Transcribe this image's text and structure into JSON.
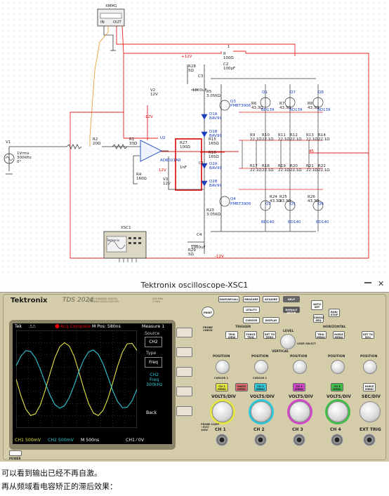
{
  "schematic": {
    "xmm1": "XMM1",
    "xmm1_in": "IN",
    "xmm1_out": "OUT",
    "v1": "V1",
    "v1_spec": "1Vrms\n300kHz\n0°",
    "r2": "R2\n20Ω",
    "r1": "R1\n33Ω",
    "u2": "U2",
    "opamp": "AD8021AR",
    "v2": "V2\n12V",
    "v3": "V3\n12V",
    "r4": "R4\n160Ω",
    "r27": "R27\n100Ω",
    "c1": "1nF",
    "c1_label": "C1",
    "plus12v": "+12V",
    "minus12v": "-12V",
    "vcc_label": "12V",
    "vee_label": "-12V",
    "r28": "R28\n5Ω",
    "c3": "C3",
    "c3_val": "1000uF",
    "r5": "R5\n3.05KΩ",
    "q3": "Q3",
    "q3_model": "PMBT3906",
    "q4": "Q4",
    "q4_model": "PMBT3906",
    "d1a": "D1A\nBAV99",
    "d1b": "D1B\nBAV99",
    "d2a": "D2A\nBAV99",
    "d2b": "D2B\nBAV99",
    "r15": "R15\n165Ω",
    "r16": "R16\n165Ω",
    "r23": "R23\n3.05KΩ",
    "c4": "C4",
    "c4_val": "1000uF",
    "r29": "R29\n5Ω",
    "r1top": "R\n100Ω",
    "c_top": "C2\n100pF",
    "top_node": "1",
    "q1": "Q1",
    "q7": "Q7",
    "q8": "Q8",
    "bd139a": "BD139",
    "bd139b": "BD139",
    "bd139c": "BD139",
    "q2": "Q2",
    "q5": "Q5",
    "q6": "Q6",
    "bd140a": "BD140",
    "bd140b": "BD140",
    "bd140c": "BD140",
    "r6": "R6\n43.3Ω",
    "r7": "R7\n43.3Ω",
    "r8": "R8\n43.3Ω",
    "r24": "R24\n43.3Ω",
    "r25": "R25\n43.3Ω",
    "r26": "R26\n43.3Ω",
    "r9": "R9\n22.1Ω",
    "r10": "R10\n22.1Ω",
    "r11": "R11\n22.1Ω",
    "r12": "R12\n22.1Ω",
    "r13": "R13\n22.1Ω",
    "r14": "R14\n22.1Ω",
    "r17": "R17\n22.1Ω",
    "r18": "R18\n22.1Ω",
    "r19": "R19\n22.1Ω",
    "r20": "R20\n22.1Ω",
    "r21": "R21\n22.1Ω",
    "r22": "R22\n22.1Ω",
    "node45": "45",
    "xsc1": "XSC1",
    "tektronix_small": "Tektronix"
  },
  "window": {
    "title": "Tektronix oscilloscope-XSC1",
    "close_glyph": "✕"
  },
  "scope": {
    "brand": "Tektronix",
    "model": "TDS 2024",
    "model_sub": "FOUR CHANNEL DIGITAL STORAGE OSCILLOSCOPE",
    "bandwidth": "200 MHz\n2 GS/s",
    "status_tek": "Tek",
    "status_trig": "Acq Complete",
    "status_mpos": "M Pos: 580ns",
    "menu_title": "Measure 1",
    "menu": [
      {
        "label": "Source",
        "value": "CH2"
      },
      {
        "label": "Type",
        "value": "Freq"
      },
      {
        "label": "CH2\nFreq\n300kHz",
        "value": ""
      },
      {
        "label": "Back",
        "value": ""
      }
    ],
    "bottom_ch1": "CH1 500mV",
    "bottom_ch2": "CH2 500mV",
    "bottom_m": "M 500ns",
    "bottom_trig": "CH1 ⁄ 0V",
    "power": "POWER",
    "buttons": {
      "print": "PRINT",
      "save_recall": "SAVE/RECALL",
      "measure": "MEASURE",
      "acquire": "ACQUIRE",
      "help": "HELP",
      "default_setup": "DEFAULT SETUP",
      "utility": "UTILITY",
      "cursor": "CURSOR",
      "display": "DISPLAY",
      "auto_set": "AUTO SET",
      "single_seq": "SINGLE SEQ",
      "run_stop": "RUN/ STOP",
      "probe_check": "PROBE CHECK",
      "trig_view": "TRIG VIEW",
      "force_trig": "FORCE TRIG",
      "set_to_zero": "SET TO ZERO",
      "trig_menu": "TRIG MENU",
      "horiz_menu": "HORIZ MENU",
      "set_to_50": "SET TO 50%",
      "ch1_menu": "CH 1 MENU",
      "math_menu": "MATH MENU",
      "ch2_menu": "CH 2 MENU",
      "ch3_menu": "CH 3 MENU",
      "ch4_menu": "CH 4 MENU"
    },
    "labels": {
      "trigger": "TRIGGER",
      "level": "LEVEL",
      "user_select": "USER SELECT",
      "horizontal": "HORIZONTAL",
      "vertical": "VERTICAL",
      "position": "POSITION",
      "cursor1": "CURSOR 1",
      "cursor2": "CURSOR 2",
      "volts_div": "VOLTS/DIV",
      "sec_div": "SEC/DIV",
      "ch1": "CH 1",
      "ch2": "CH 2",
      "ch3": "CH 3",
      "ch4": "CH 4",
      "ext_trig": "EXT TRIG",
      "probe_comp": "PROBE COMP\n~5V@\n1kHz"
    },
    "colors": {
      "ch1": "#e5e541",
      "ch2": "#2fc7d6",
      "ch3": "#d147c9",
      "ch4": "#3fbf4a",
      "math": "#c33b3b"
    }
  },
  "chart_data": {
    "type": "line",
    "x_unit": "ns",
    "x": [
      0,
      200,
      400,
      600,
      800,
      1000,
      1200,
      1400,
      1600,
      1800,
      2000,
      2200,
      2400,
      2600,
      2800,
      3000,
      3200,
      3400,
      3600,
      3800,
      4000,
      4200,
      4400,
      4600,
      4800,
      5000
    ],
    "series": [
      {
        "name": "CH1",
        "values": [
          0.0,
          -0.69,
          -1.23,
          -1.49,
          -1.42,
          -1.06,
          -0.46,
          0.23,
          0.87,
          1.32,
          1.5,
          1.36,
          0.94,
          0.3,
          -0.39,
          -1.0,
          -1.39,
          -1.49,
          -1.28,
          -0.8,
          -0.14,
          0.54,
          1.11,
          1.45,
          1.47,
          1.18
        ]
      },
      {
        "name": "CH2",
        "values": [
          0.55,
          0.95,
          1.17,
          1.14,
          0.87,
          0.41,
          -0.14,
          -0.65,
          -1.04,
          -1.19,
          -1.09,
          -0.75,
          -0.25,
          0.32,
          0.8,
          1.12,
          1.2,
          1.02,
          0.63,
          0.09,
          -0.47,
          -0.92,
          -1.17,
          -1.15,
          -0.89,
          -0.41
        ]
      }
    ],
    "ylim": [
      -2,
      2
    ],
    "xlim": [
      0,
      5000
    ],
    "grid": true
  },
  "caption": {
    "line1": "可以看到输出已经不再自激。",
    "line2": "再从频域看电容矫正的滞后效果："
  }
}
